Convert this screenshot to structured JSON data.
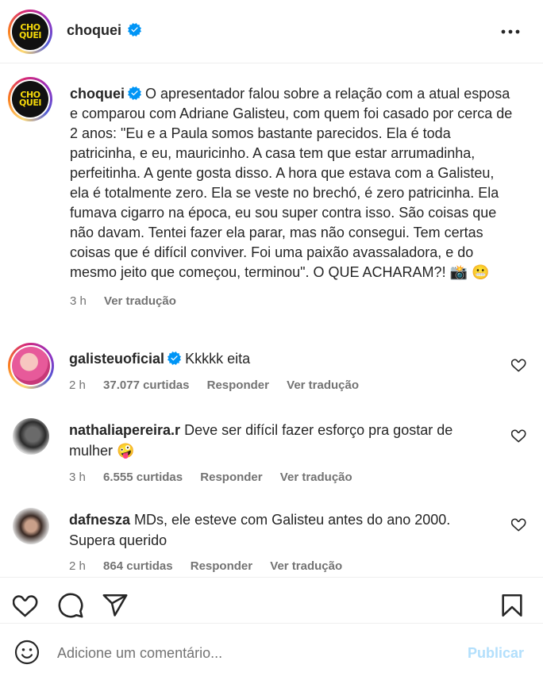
{
  "header": {
    "username": "choquei",
    "logo_text_1": "CHO",
    "logo_text_2": "QUEI",
    "more_icon": "more-horizontal-icon"
  },
  "post": {
    "username": "choquei",
    "caption": "O apresentador falou sobre a relação com a atual esposa e comparou com Adriane Galisteu, com quem foi casado por cerca de 2 anos: \"Eu e a Paula somos bastante parecidos. Ela é toda patricinha, e eu, mauricinho. A casa tem que estar arrumadinha, perfeitinha. A gente gosta disso. A hora que estava com a Galisteu, ela é totalmente zero. Ela se veste no brechó, é zero patricinha. Ela fumava cigarro na época, eu sou super contra isso. São coisas que não davam. Tentei fazer ela parar, mas não consegui. Tem certas coisas que é difícil conviver. Foi uma paixão avassaladora, e do mesmo jeito que começou, terminou\". O QUE ACHARAM?! 📸 😬",
    "time": "3 h",
    "translate": "Ver tradução"
  },
  "comments": [
    {
      "username": "galisteuoficial",
      "verified": true,
      "text": "Kkkkk eita",
      "time": "2 h",
      "likes": "37.077 curtidas",
      "reply": "Responder",
      "translate": "Ver tradução"
    },
    {
      "username": "nathaliapereira.r",
      "verified": false,
      "text": "Deve ser difícil fazer esforço pra gostar de mulher 🤪",
      "time": "3 h",
      "likes": "6.555 curtidas",
      "reply": "Responder",
      "translate": "Ver tradução"
    },
    {
      "username": "dafnesza",
      "verified": false,
      "text": "MDs, ele esteve com Galisteu antes do ano 2000. Supera querido",
      "time": "2 h",
      "likes": "864 curtidas",
      "reply": "Responder",
      "translate": "Ver tradução"
    }
  ],
  "actions": {
    "like_icon": "heart-icon",
    "comment_icon": "comment-icon",
    "share_icon": "share-icon",
    "save_icon": "bookmark-icon"
  },
  "add_comment": {
    "placeholder": "Adicione um comentário...",
    "publish": "Publicar"
  },
  "colors": {
    "verified": "#0095f6",
    "publish": "#b2dffc",
    "muted": "#737373"
  }
}
